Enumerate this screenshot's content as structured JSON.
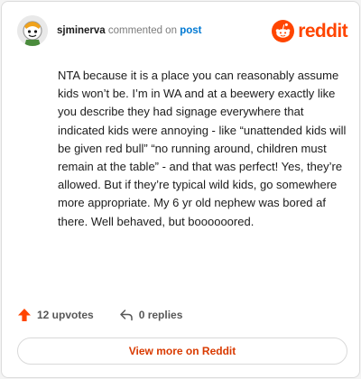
{
  "comment": {
    "username": "sjminerva",
    "action_text": "commented on",
    "post_link": "post",
    "body": "NTA because it is a place you can reasonably assume kids won’t be. I’m in WA and at a beewery exactly like you describe they had signage everywhere that indicated kids were annoying - like “unattended kids will be given red bull” “no running around, children must remain at the table” - and that was perfect! Yes, they’re allowed. But if they’re typical wild kids, go somewhere more appropriate. My 6 yr old nephew was bored af there. Well behaved, but boooooored."
  },
  "brand": {
    "wordmark": "reddit",
    "color": "#ff4500"
  },
  "stats": {
    "upvotes_label": "12 upvotes",
    "replies_label": "0 replies"
  },
  "cta": {
    "label": "View more on Reddit",
    "color": "#d93a00"
  },
  "icons": {
    "avatar": "snoo-avatar-icon",
    "logo": "reddit-logo-icon",
    "upvote": "upvote-arrow-icon",
    "reply": "reply-arrow-icon"
  }
}
